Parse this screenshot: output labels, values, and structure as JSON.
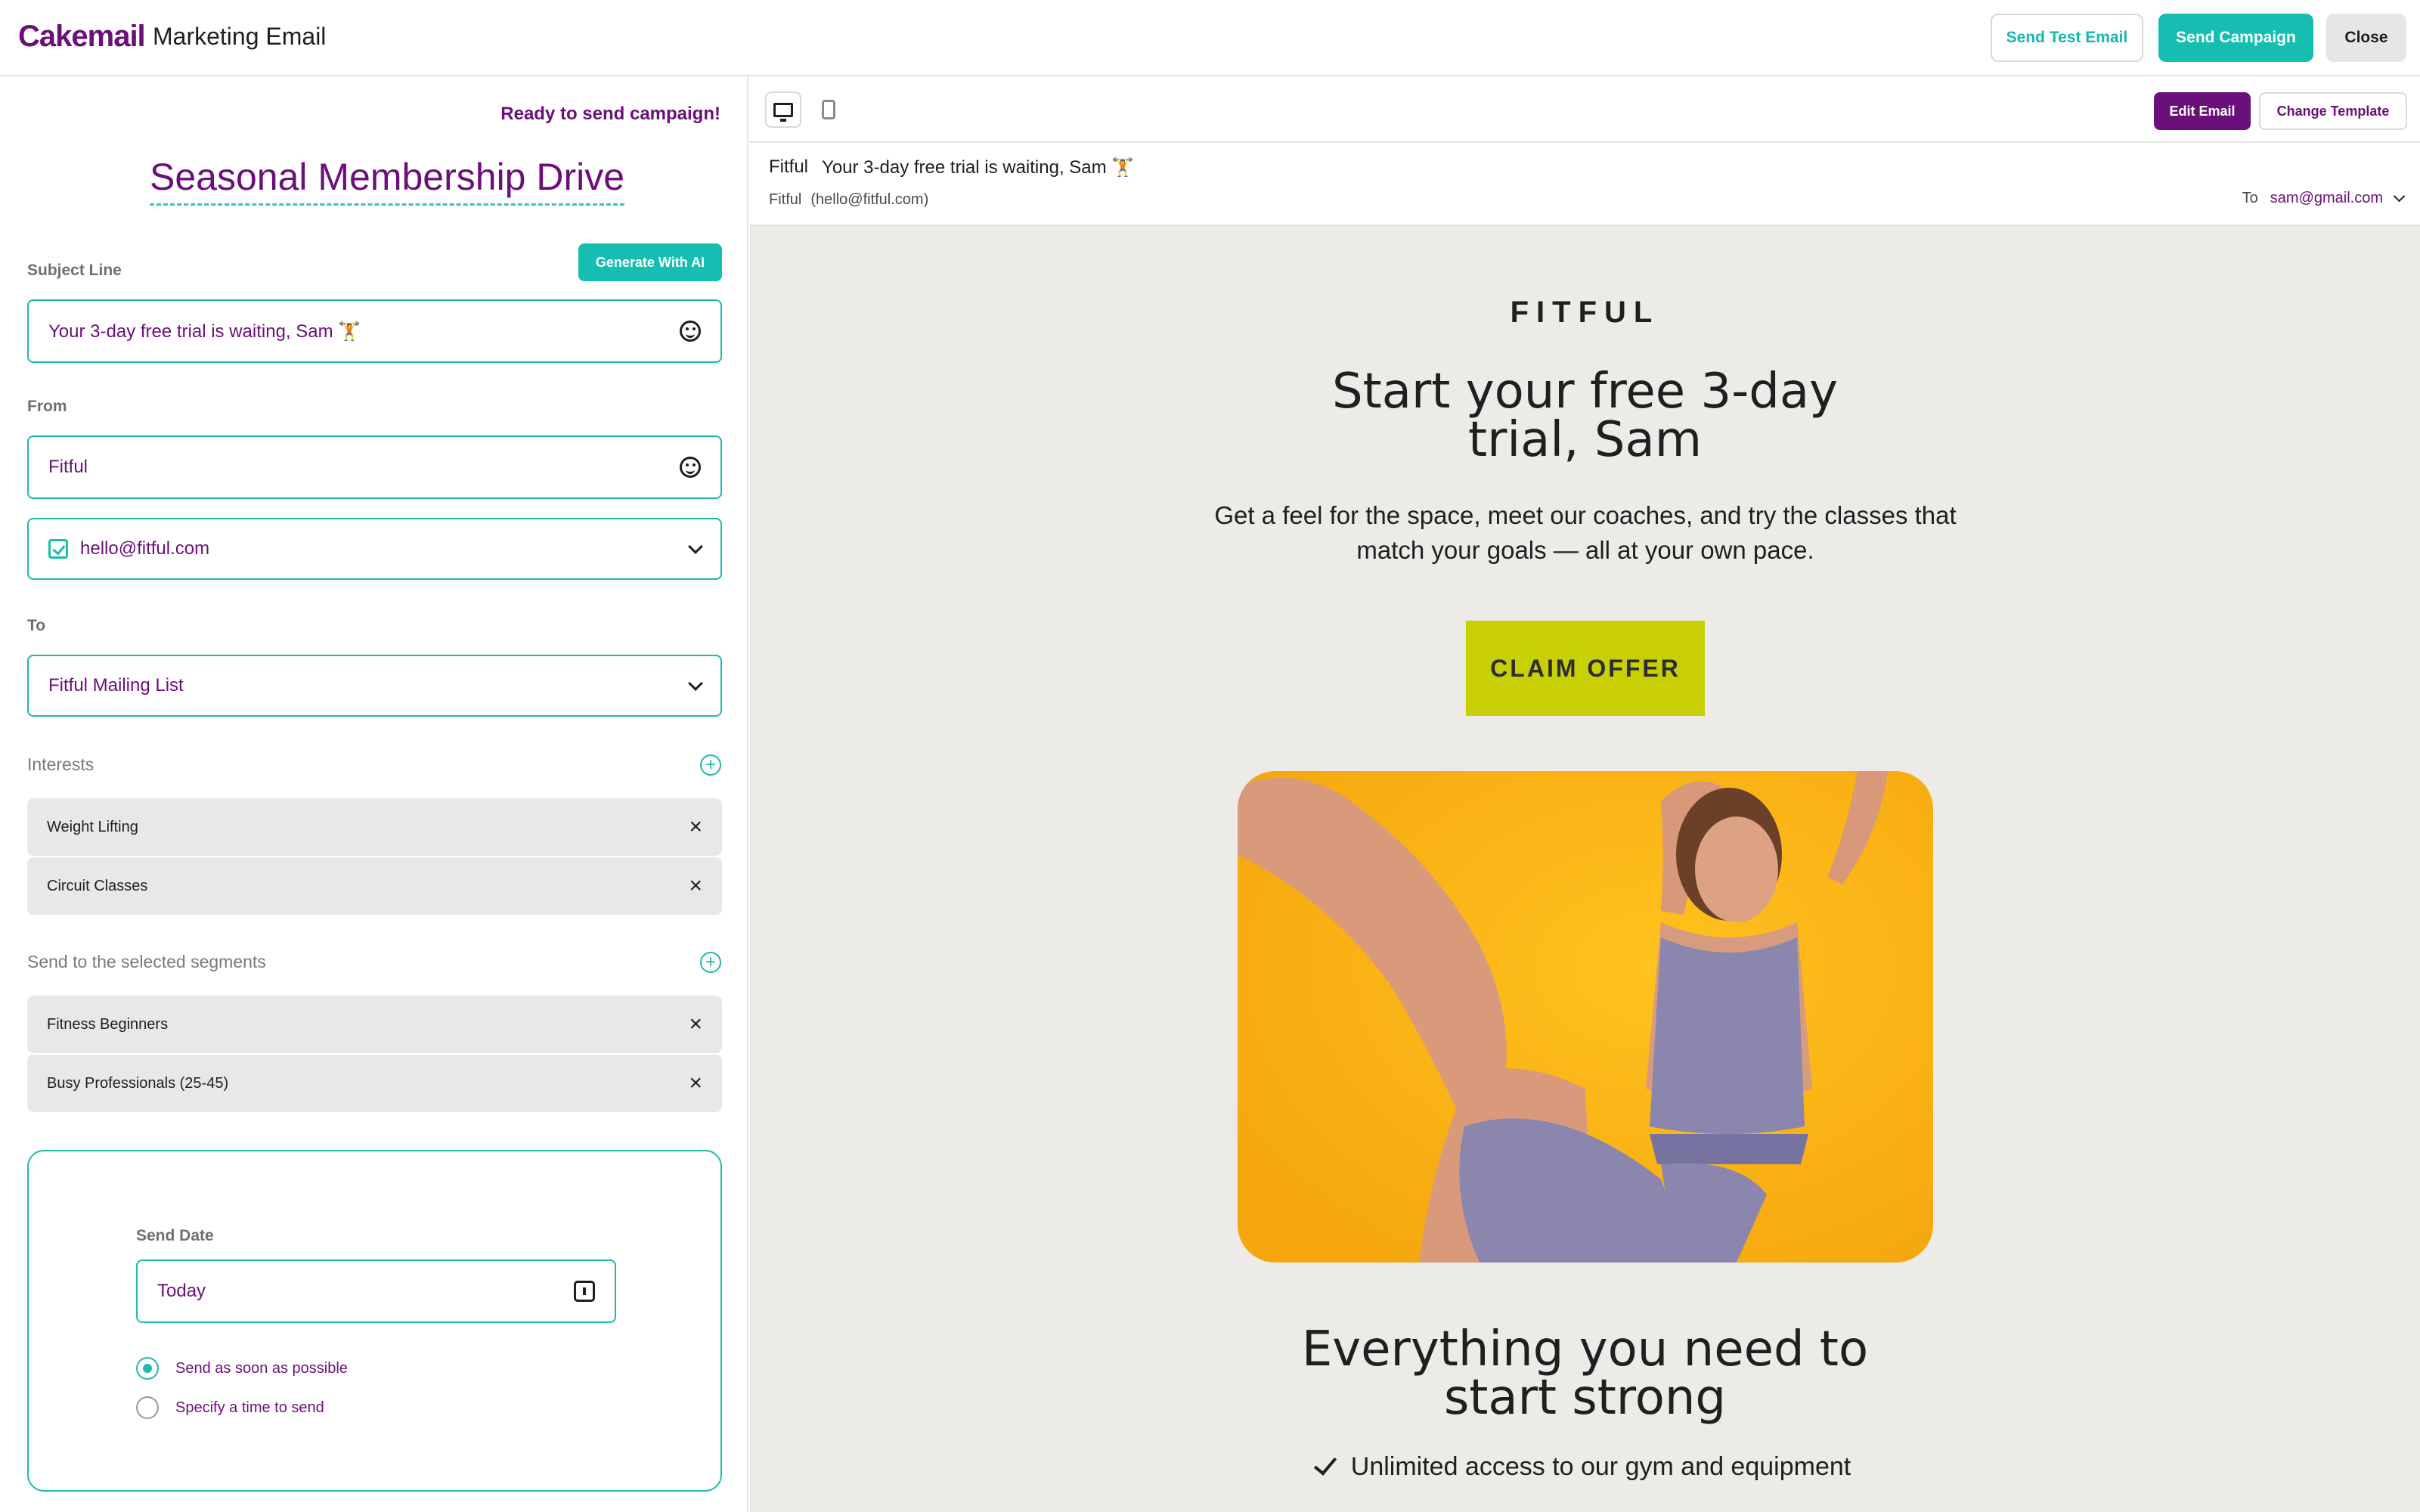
{
  "app": {
    "logo": "Cakemail",
    "title": "Marketing Email",
    "actions": {
      "send_test": "Send Test Email",
      "send_campaign": "Send Campaign",
      "close": "Close"
    }
  },
  "editor": {
    "status": "Ready to send campaign!",
    "campaign_name": "Seasonal Membership Drive",
    "generate_ai": "Generate With AI",
    "subject": {
      "label": "Subject Line",
      "value": "Your 3-day free trial is waiting, Sam 🏋️"
    },
    "from": {
      "label": "From",
      "name": "Fitful",
      "email": "hello@fitful.com"
    },
    "to": {
      "label": "To",
      "list": "Fitful Mailing List"
    },
    "interests": {
      "label": "Interests",
      "items": [
        {
          "label": "Weight Lifting"
        },
        {
          "label": "Circuit Classes"
        }
      ]
    },
    "segments": {
      "label": "Send to the selected segments",
      "items": [
        {
          "label": "Fitness Beginners"
        },
        {
          "label": "Busy Professionals (25-45)"
        }
      ]
    },
    "schedule": {
      "label": "Send Date",
      "date": "Today",
      "options": [
        {
          "label": "Send as soon as possible",
          "selected": true
        },
        {
          "label": "Specify a time to send",
          "selected": false
        }
      ]
    }
  },
  "preview": {
    "edit_email": "Edit Email",
    "change_template": "Change Template",
    "sender_name": "Fitful",
    "subject": "Your 3-day free trial is waiting, Sam 🏋️",
    "sender_email": "(hello@fitful.com)",
    "to_label": "To",
    "to_value": "sam@gmail.com",
    "email": {
      "brand": "FITFUL",
      "headline_1": "Start your free 3-day",
      "headline_2": "trial, Sam",
      "body": "Get a feel for the space, meet our coaches, and try the classes that match your goals — all at your own pace.",
      "cta": "CLAIM OFFER",
      "section_title_1": "Everything you need to",
      "section_title_2": "start strong",
      "feature_1": "Unlimited access to our gym and equipment"
    }
  },
  "colors": {
    "brand_purple": "#6b0f7a",
    "accent_teal": "#16bdb1",
    "cta_yellow": "#c8cf05",
    "hero_background": "#fbb515"
  }
}
